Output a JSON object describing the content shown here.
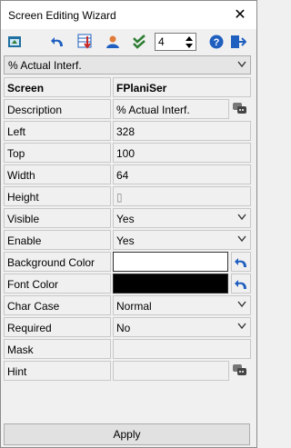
{
  "window": {
    "title": "Screen Editing Wizard"
  },
  "toolbar": {
    "stepper_value": "4"
  },
  "selector": {
    "value": "% Actual Interf."
  },
  "rows": {
    "screen": {
      "label": "Screen",
      "value": "FPlaniSer"
    },
    "description": {
      "label": "Description",
      "value": "% Actual Interf."
    },
    "left": {
      "label": "Left",
      "value": "328"
    },
    "top": {
      "label": "Top",
      "value": "100"
    },
    "width": {
      "label": "Width",
      "value": "64"
    },
    "height": {
      "label": "Height",
      "value": "▯"
    },
    "visible": {
      "label": "Visible",
      "value": "Yes"
    },
    "enable": {
      "label": "Enable",
      "value": "Yes"
    },
    "background_color": {
      "label": "Background Color",
      "value": "#ffffff"
    },
    "font_color": {
      "label": "Font Color",
      "value": "#000000"
    },
    "char_case": {
      "label": "Char Case",
      "value": "Normal"
    },
    "required": {
      "label": "Required",
      "value": "No"
    },
    "mask": {
      "label": "Mask",
      "value": ""
    },
    "hint": {
      "label": "Hint",
      "value": ""
    }
  },
  "footer": {
    "apply_label": "Apply"
  },
  "colors": {
    "accent_blue": "#1f5fbf",
    "check_green": "#2e7d32",
    "close_red": "#c62828"
  }
}
